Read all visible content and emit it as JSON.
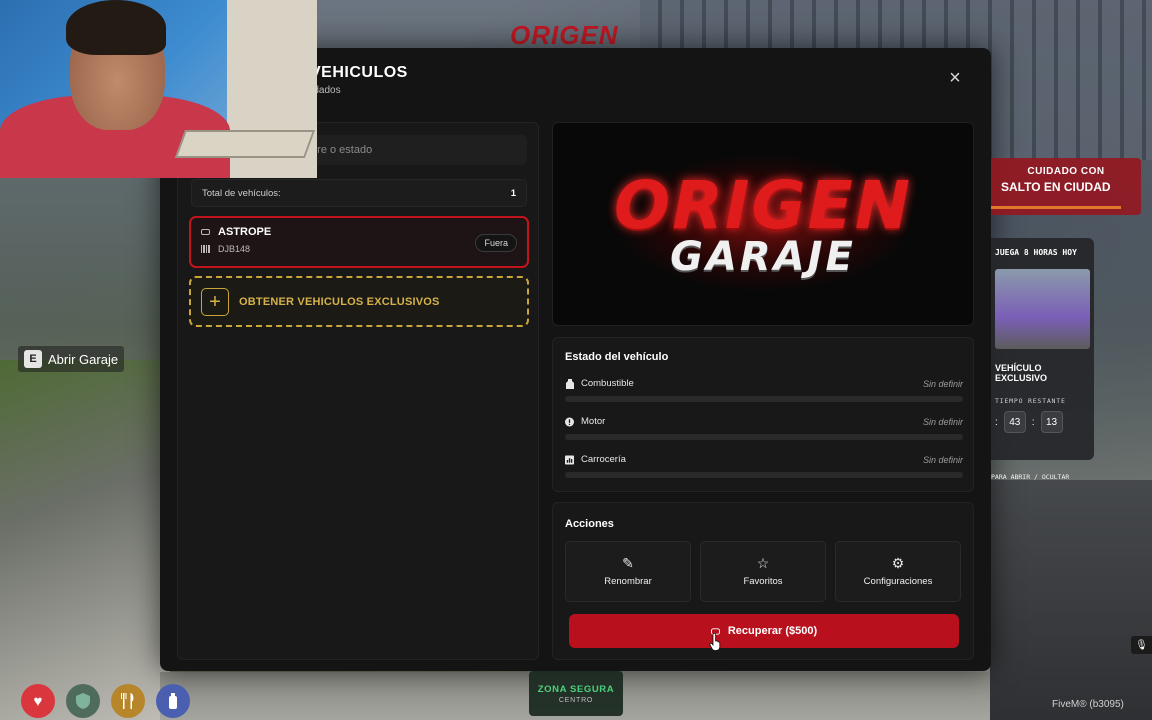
{
  "modal": {
    "title": "VEHICULOS",
    "subtitle": "rdados",
    "close_glyph": "×"
  },
  "list": {
    "search_placeholder": "Buscar por placa, nombre o estado",
    "total_label": "Total de vehículos:",
    "total_count": "1",
    "vehicles": [
      {
        "name": "ASTROPE",
        "plate": "DJB148",
        "status": "Fuera"
      }
    ],
    "exclusive_label": "OBTENER VEHICULOS EXCLUSIVOS"
  },
  "banner": {
    "brand": "ORIGEN",
    "sub": "GARAJE"
  },
  "vehicle_status": {
    "title": "Estado del vehículo",
    "stats": [
      {
        "label": "Combustible",
        "value": "Sin definir",
        "icon": "fuel-icon",
        "level": 0
      },
      {
        "label": "Motor",
        "value": "Sin definir",
        "icon": "engine-alert-icon",
        "level": 0
      },
      {
        "label": "Carrocería",
        "value": "Sin definir",
        "icon": "chart-icon",
        "level": 0
      }
    ]
  },
  "actions": {
    "title": "Acciones",
    "items": [
      {
        "label": "Renombrar",
        "icon": "pencil-icon",
        "glyph": "✎"
      },
      {
        "label": "Favoritos",
        "icon": "star-icon",
        "glyph": "☆"
      },
      {
        "label": "Configuraciones",
        "icon": "gear-icon",
        "glyph": "⚙"
      }
    ],
    "recover_label": "Recuperar ($500)"
  },
  "hud": {
    "prompt_key": "E",
    "prompt_text": "Abrir Garaje",
    "warning_line1": "CUIDADO CON",
    "warning_line2": "SALTO EN CIUDAD",
    "promo_title": "JUEGA 8 HORAS HOY",
    "promo_vehicle": "VEHÍCULO EXCLUSIVO",
    "promo_time_label": "TIEMPO RESTANTE",
    "promo_minutes": "43",
    "promo_seconds": "13",
    "promo_hint": "PARA ABRIR / OCULTAR",
    "zone_title": "ZONA SEGURA",
    "zone_sub": "CENTRO",
    "fivem": "FiveM® (b3095)",
    "sign": "ORIGEN"
  },
  "colors": {
    "accent": "#c3141d",
    "gold": "#c9a53a",
    "safe_zone": "#4bd17a"
  }
}
